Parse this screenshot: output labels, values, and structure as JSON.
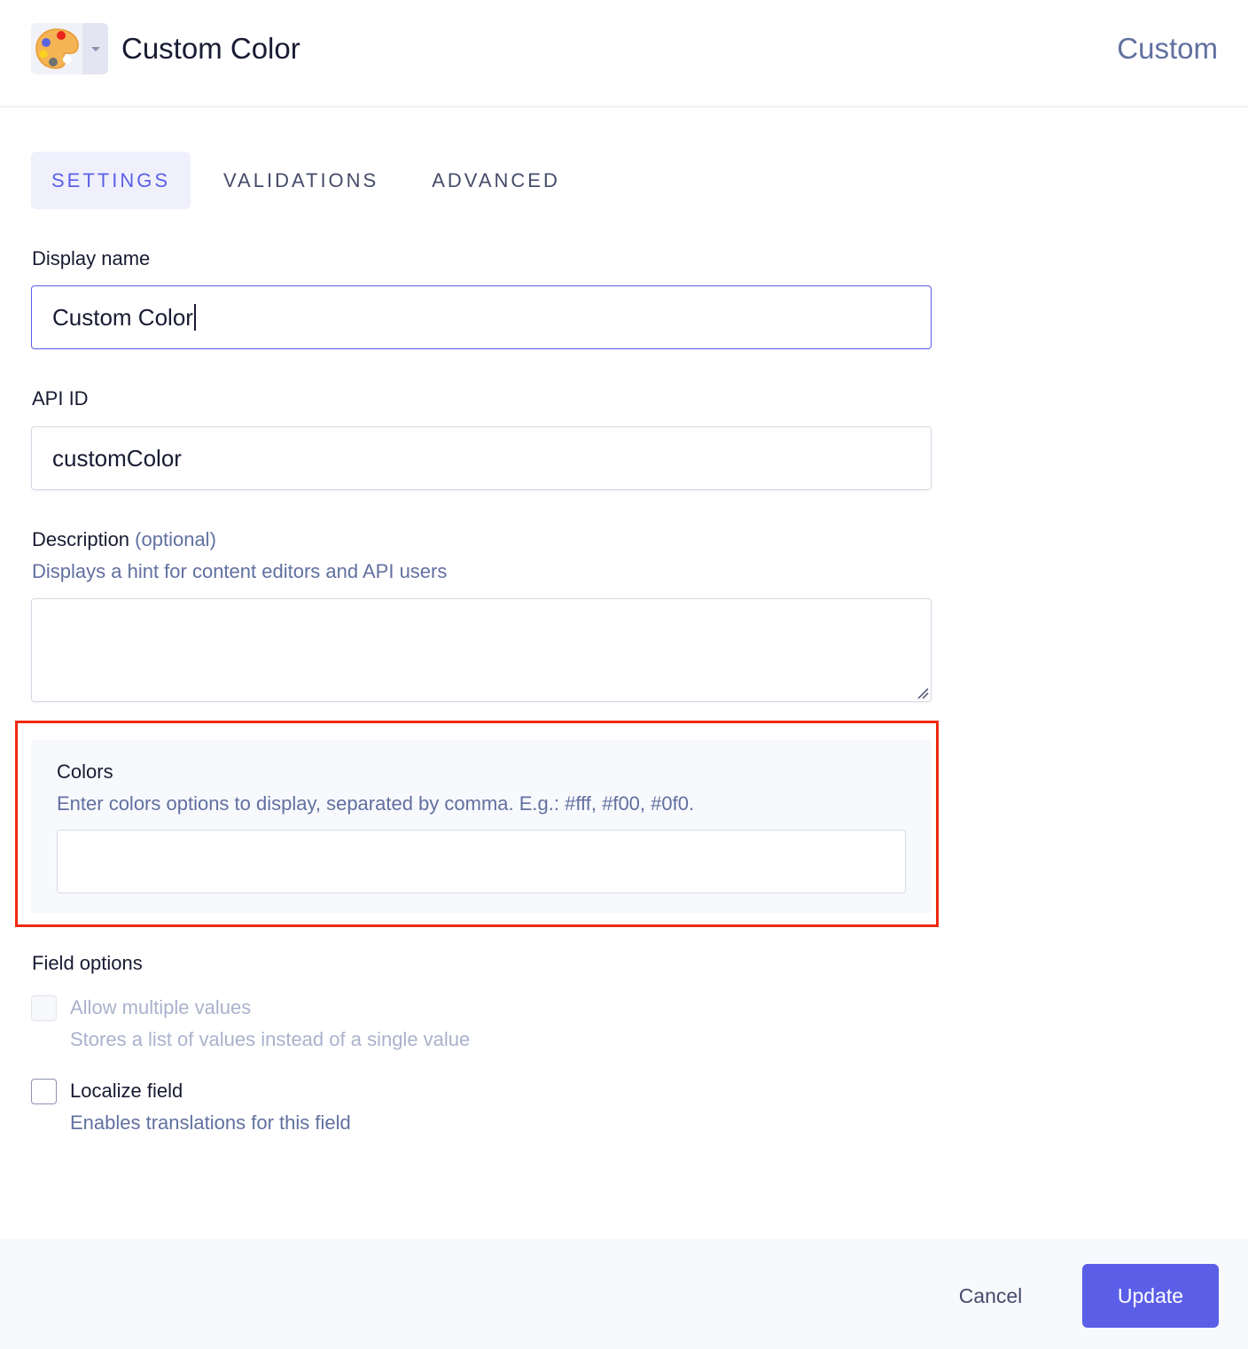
{
  "header": {
    "icon": "artist-palette-icon",
    "title": "Custom Color",
    "field_type": "Custom"
  },
  "tabs": [
    {
      "label": "SETTINGS",
      "active": true
    },
    {
      "label": "VALIDATIONS",
      "active": false
    },
    {
      "label": "ADVANCED",
      "active": false
    }
  ],
  "form": {
    "display_name": {
      "label": "Display name",
      "value": "Custom Color"
    },
    "api_id": {
      "label": "API ID",
      "value": "customColor"
    },
    "description": {
      "label": "Description",
      "optional": "(optional)",
      "hint": "Displays a hint for content editors and API users",
      "value": ""
    },
    "colors": {
      "label": "Colors",
      "hint": "Enter colors options to display, separated by comma. E.g.: #fff, #f00, #0f0.",
      "value": ""
    }
  },
  "field_options": {
    "title": "Field options",
    "items": [
      {
        "label": "Allow multiple values",
        "description": "Stores a list of values instead of a single value",
        "checked": false,
        "disabled": true
      },
      {
        "label": "Localize field",
        "description": "Enables translations for this field",
        "checked": false,
        "disabled": false
      }
    ]
  },
  "footer": {
    "cancel_label": "Cancel",
    "update_label": "Update"
  },
  "colors": {
    "accent": "#5b5fe8",
    "highlight_border": "#ee2a10"
  }
}
